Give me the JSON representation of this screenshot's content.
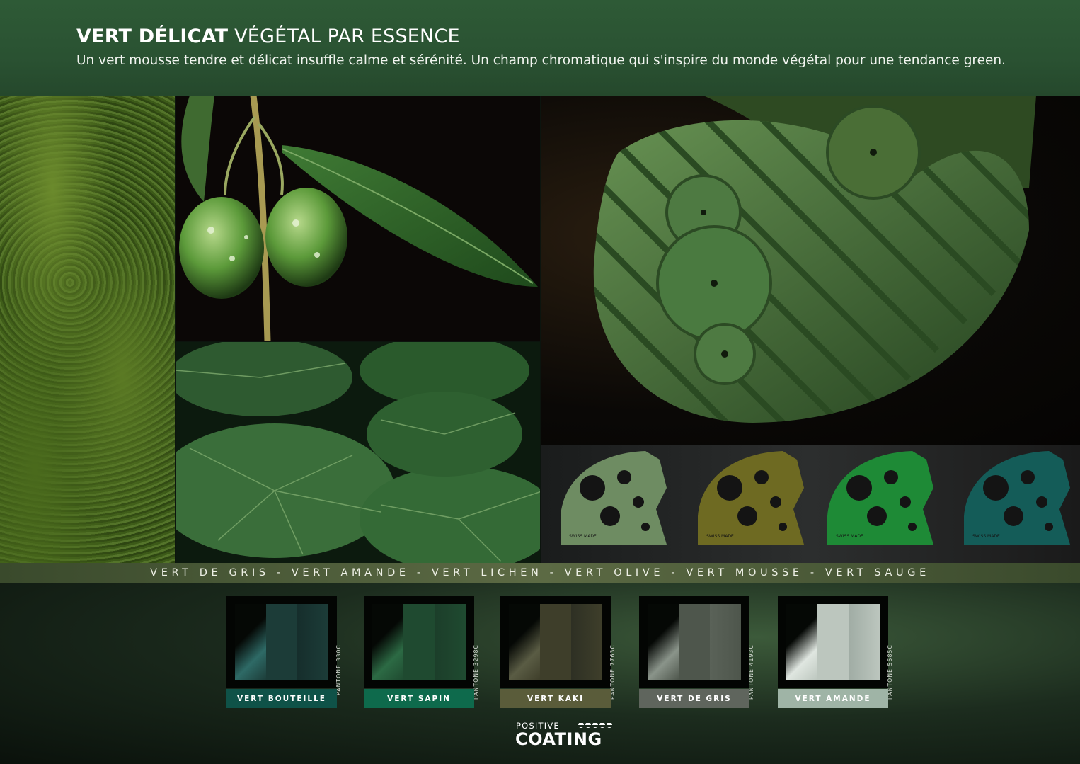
{
  "header": {
    "title_bold": "VERT DÉLICAT",
    "title_rest": "VÉGÉTAL PAR ESSENCE",
    "subtitle": "Un vert mousse tendre et délicat insuffle calme et sérénité. Un champ chromatique qui s'inspire du monde végétal pour une tendance green."
  },
  "band": {
    "text": "VERT DE GRIS - VERT AMANDE - VERT LICHEN - VERT OLIVE - VERT MOUSSE - VERT SAUGE"
  },
  "variants": [
    {
      "engraving": "SWISS MADE",
      "color": "#6e8c62"
    },
    {
      "engraving": "SWISS MADE",
      "color": "#6e6a22"
    },
    {
      "engraving": "SWISS MADE",
      "color": "#1e8a36"
    },
    {
      "engraving": "SWISS MADE",
      "color": "#145c58"
    }
  ],
  "swatches": [
    {
      "name": "VERT BOUTEILLE",
      "pantone": "PANTONE 330C",
      "label_color": "#0f5248",
      "mid": "#1c3c38",
      "right": "#162e2c",
      "grad": "#2e6a66"
    },
    {
      "name": "VERT SAPIN",
      "pantone": "PANTONE 3298C",
      "label_color": "#0e6a4c",
      "mid": "#1f4a30",
      "right": "#1c3e2a",
      "grad": "#2c6a44"
    },
    {
      "name": "VERT KAKI",
      "pantone": "PANTONE 7763C",
      "label_color": "#5a5c3a",
      "mid": "#3e3e2a",
      "right": "#2e3024",
      "grad": "#5a5c44"
    },
    {
      "name": "VERT DE GRIS",
      "pantone": "PANTONE 4193C",
      "label_color": "#5f655d",
      "mid": "#4e564c",
      "right": "#5a6258",
      "grad": "#8a948a"
    },
    {
      "name": "VERT AMANDE",
      "pantone": "PANTONE 5585C",
      "label_color": "#9fb4a6",
      "mid": "#bcc6be",
      "right": "#a0aca4",
      "grad": "#dfe6e0"
    }
  ],
  "logo": {
    "top": "POSITIVE",
    "main": "COATING"
  }
}
